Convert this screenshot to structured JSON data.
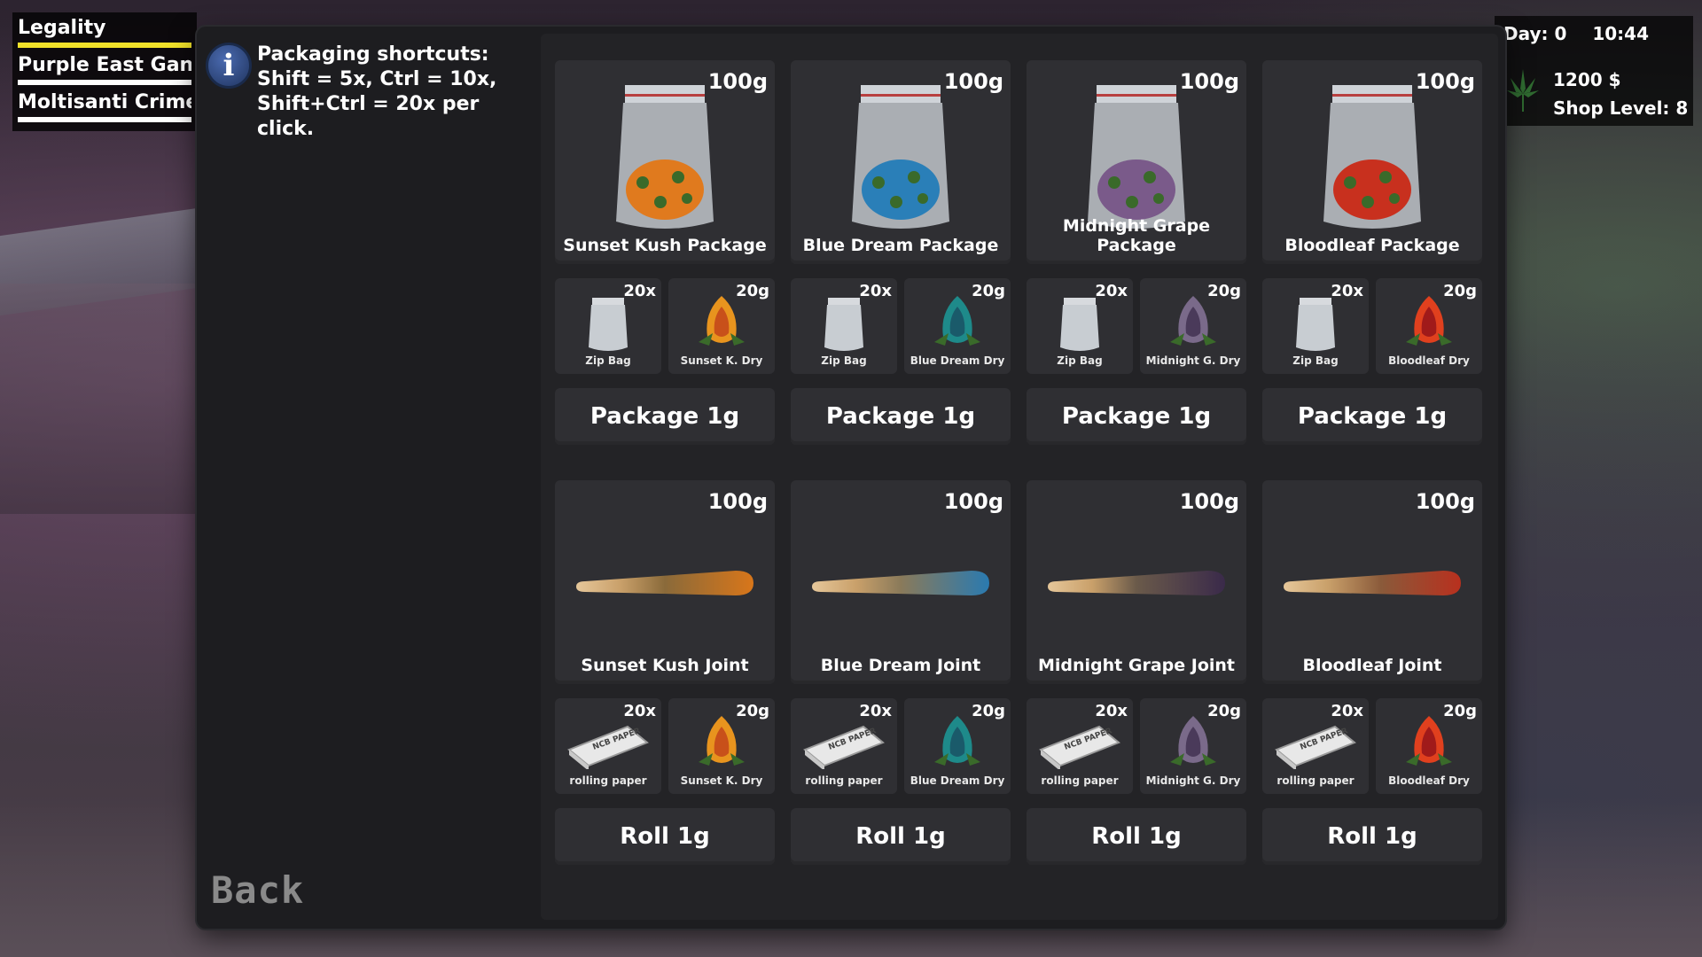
{
  "factions": [
    {
      "name": "Legality",
      "bar_color": "#f0e12a"
    },
    {
      "name": "Purple East Gang",
      "bar_color": "#ffffff"
    },
    {
      "name": "Moltisanti Crime Family",
      "bar_color": "#ffffff"
    }
  ],
  "hud": {
    "day": "Day: 0",
    "time": "10:44",
    "money": "1200 $",
    "shop_level": "Shop Level: 8"
  },
  "info": {
    "icon": "info-icon",
    "text": "Packaging shortcuts: Shift = 5x, Ctrl = 10x, Shift+Ctrl = 20x per click."
  },
  "back_label": "Back",
  "packages": [
    {
      "amount": "100g",
      "name": "Sunset Kush Package",
      "color": "#e07a1e",
      "ing1_qty": "20x",
      "ing1_label": "Zip Bag",
      "ing2_qty": "20g",
      "ing2_label": "Sunset K. Dry",
      "action": "Package 1g"
    },
    {
      "amount": "100g",
      "name": "Blue Dream Package",
      "color": "#2a7fb8",
      "ing1_qty": "20x",
      "ing1_label": "Zip Bag",
      "ing2_qty": "20g",
      "ing2_label": "Blue Dream Dry",
      "action": "Package 1g"
    },
    {
      "amount": "100g",
      "name": "Midnight Grape Package",
      "color": "#7a5a8a",
      "ing1_qty": "20x",
      "ing1_label": "Zip Bag",
      "ing2_qty": "20g",
      "ing2_label": "Midnight G. Dry",
      "action": "Package 1g"
    },
    {
      "amount": "100g",
      "name": "Bloodleaf Package",
      "color": "#c8301e",
      "ing1_qty": "20x",
      "ing1_label": "Zip Bag",
      "ing2_qty": "20g",
      "ing2_label": "Bloodleaf Dry",
      "action": "Package 1g"
    }
  ],
  "joints": [
    {
      "amount": "100g",
      "name": "Sunset Kush Joint",
      "color": "#d8761a",
      "ing1_qty": "20x",
      "ing1_label": "rolling paper",
      "ing2_qty": "20g",
      "ing2_label": "Sunset K. Dry",
      "action": "Roll 1g"
    },
    {
      "amount": "100g",
      "name": "Blue Dream Joint",
      "color": "#2a7ab0",
      "ing1_qty": "20x",
      "ing1_label": "rolling paper",
      "ing2_qty": "20g",
      "ing2_label": "Blue Dream Dry",
      "action": "Roll 1g"
    },
    {
      "amount": "100g",
      "name": "Midnight Grape Joint",
      "color": "#4a3a5a",
      "ing1_qty": "20x",
      "ing1_label": "rolling paper",
      "ing2_qty": "20g",
      "ing2_label": "Midnight G. Dry",
      "action": "Roll 1g"
    },
    {
      "amount": "100g",
      "name": "Bloodleaf Joint",
      "color": "#b8301e",
      "ing1_qty": "20x",
      "ing1_label": "rolling paper",
      "ing2_qty": "20g",
      "ing2_label": "Bloodleaf Dry",
      "action": "Roll 1g"
    }
  ],
  "paper_brand": "NCB PAPER"
}
